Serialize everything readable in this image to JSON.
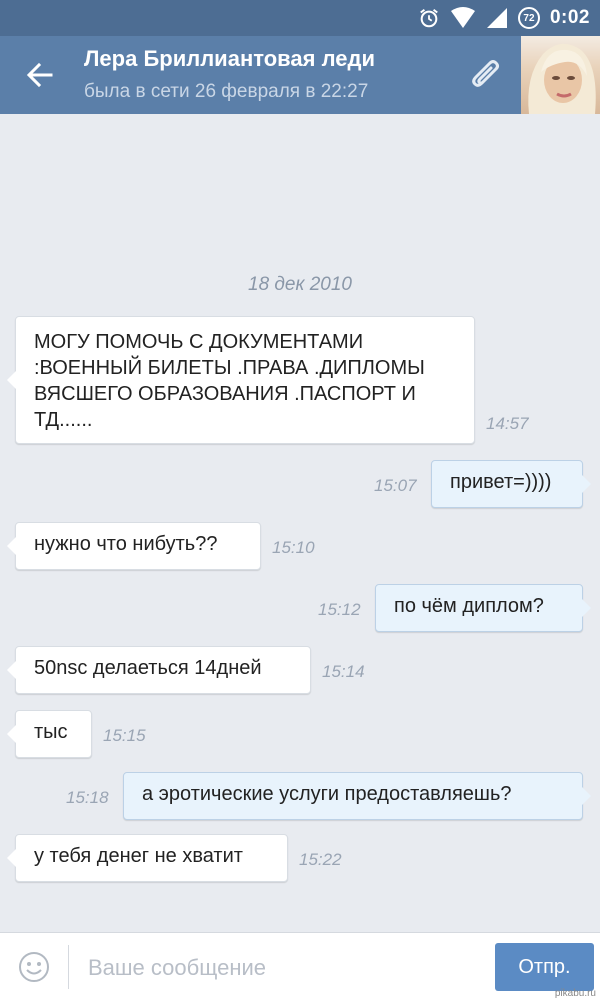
{
  "status_bar": {
    "battery": "72",
    "time": "0:02"
  },
  "header": {
    "contact_name": "Лера Бриллиантовая леди",
    "contact_status": "была в сети 26 февраля в 22:27"
  },
  "chat": {
    "date": "18 дек 2010",
    "messages": [
      {
        "dir": "in",
        "text": "МОГУ ПОМОЧЬ С ДОКУМЕНТАМИ :ВОЕННЫЙ БИЛЕТЫ .ПРАВА .ДИПЛОМЫ ВЯСШЕГО ОБРАЗОВАНИЯ .ПАСПОРТ И ТД......",
        "time": "14:57"
      },
      {
        "dir": "out",
        "text": "привет=))))",
        "time": "15:07"
      },
      {
        "dir": "in",
        "text": "нужно что нибуть??",
        "time": "15:10"
      },
      {
        "dir": "out",
        "text": "по чём диплом?",
        "time": "15:12"
      },
      {
        "dir": "in",
        "text": "50nsc делаеться 14дней",
        "time": "15:14"
      },
      {
        "dir": "in",
        "text": "тыс",
        "time": "15:15"
      },
      {
        "dir": "out",
        "text": "а эротические услуги предоставляешь?",
        "time": "15:18"
      },
      {
        "dir": "in",
        "text": "у тебя денег не хватит",
        "time": "15:22"
      }
    ]
  },
  "input": {
    "placeholder": "Ваше сообщение",
    "send_label": "Отпр."
  },
  "watermark": "pikabu.ru",
  "colors": {
    "header": "#5b7fa9",
    "status_bar": "#4d6d93",
    "background": "#e8ebf0",
    "outgoing_bubble": "#e8f3fc",
    "send_button": "#5b8bc4"
  }
}
